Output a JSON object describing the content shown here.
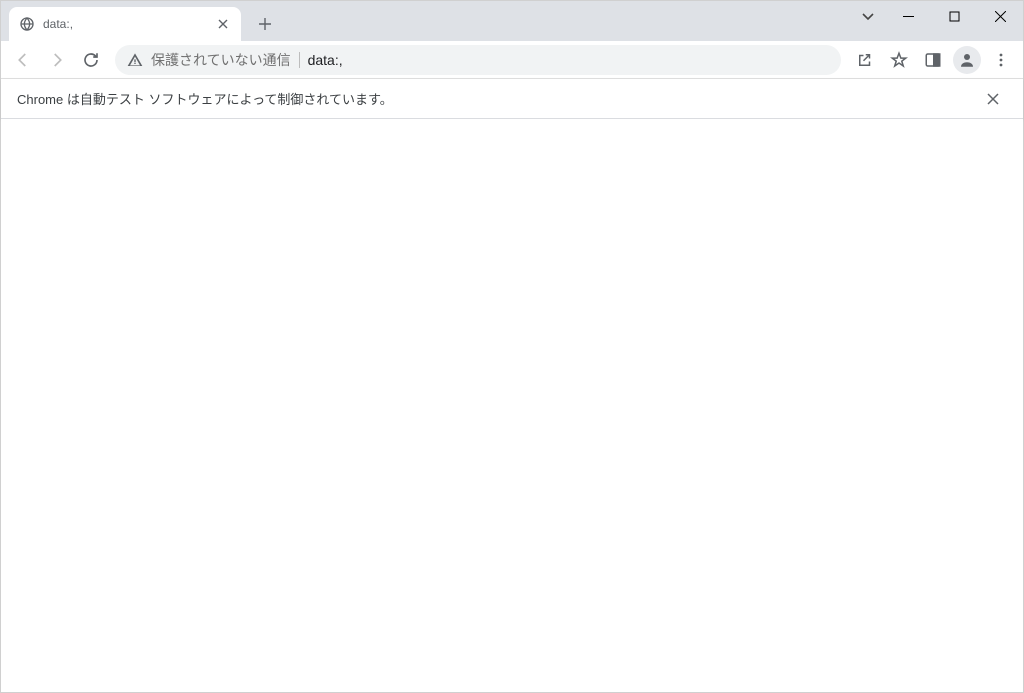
{
  "tab": {
    "title": "data:,"
  },
  "omnibox": {
    "security_text": "保護されていない通信",
    "url": "data:,"
  },
  "infobar": {
    "message": "Chrome は自動テスト ソフトウェアによって制御されています。"
  }
}
